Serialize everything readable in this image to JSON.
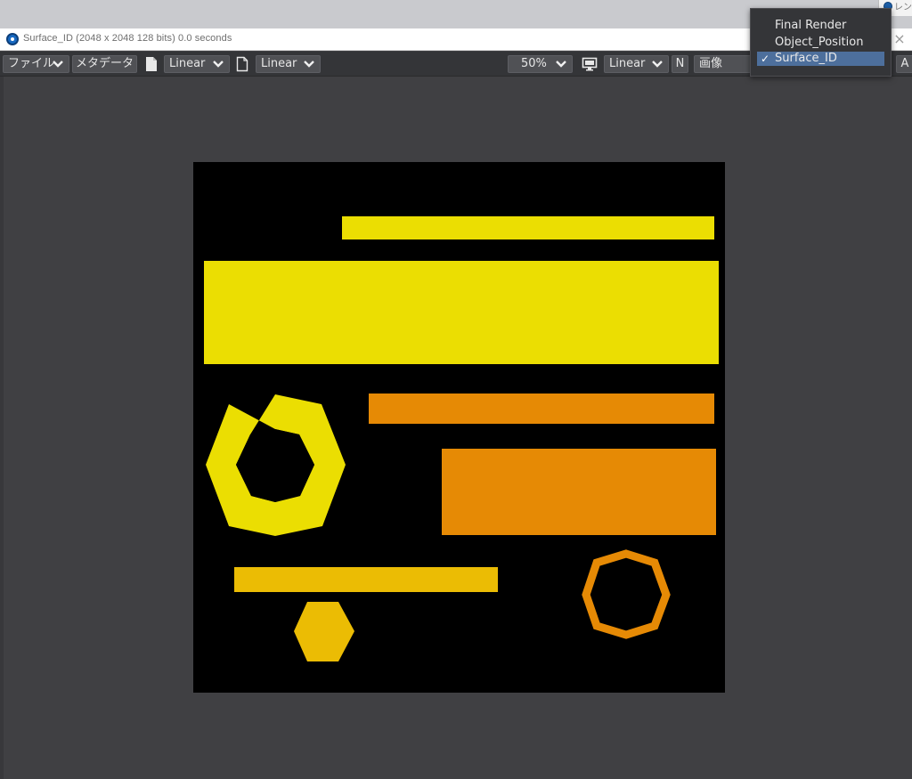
{
  "window": {
    "title": "Surface_ID (2048 x 2048 128 bits) 0.0 seconds",
    "close_glyph": "×",
    "background_tab_label": "レン"
  },
  "toolbar": {
    "file_menu": "ファイル",
    "metadata_button": "メタデータ",
    "input_colorspace": "Linear",
    "output_colorspace": "Linear",
    "zoom": "50%",
    "display_colorspace": "Linear",
    "n_button": "N",
    "image_dropdown": "画像",
    "a_button": "A"
  },
  "layer_menu": {
    "items": [
      {
        "label": "Final Render",
        "checked": false
      },
      {
        "label": "Object_Position",
        "checked": false
      },
      {
        "label": "Surface_ID",
        "checked": true
      }
    ],
    "check_glyph": "✓"
  },
  "render": {
    "background_color": "#000000",
    "colors": {
      "yellow": "#ebde02",
      "orange": "#e68a05",
      "gold": "#ebbc04"
    }
  },
  "icons": {
    "chevron": "chevron-down-icon",
    "document": "document-icon",
    "page": "page-icon",
    "monitor": "monitor-icon",
    "app": "app-logo-icon"
  }
}
